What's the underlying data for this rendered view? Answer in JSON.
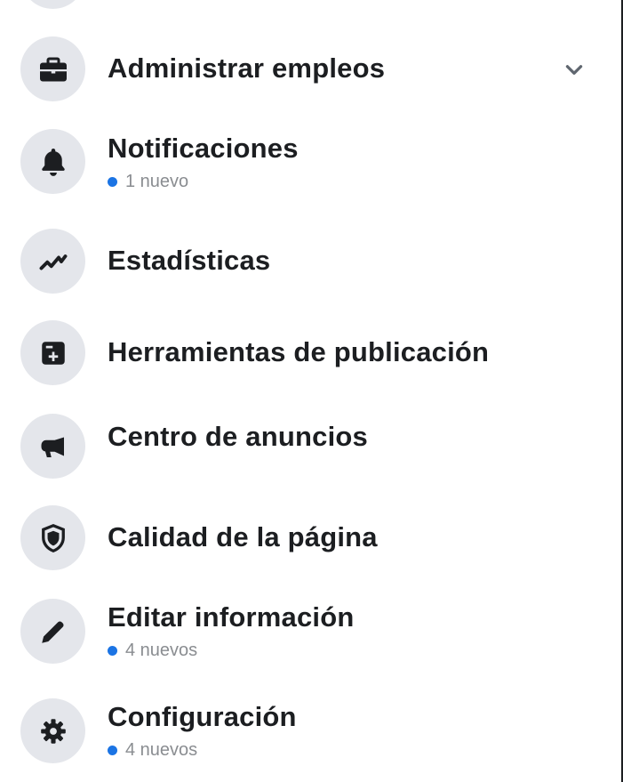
{
  "menu": {
    "items": [
      {
        "id": "administrar-empleos",
        "label": "Administrar empleos",
        "icon": "briefcase-icon",
        "expandable": true
      },
      {
        "id": "notificaciones",
        "label": "Notificaciones",
        "icon": "bell-icon",
        "badge": "1 nuevo"
      },
      {
        "id": "estadisticas",
        "label": "Estadísticas",
        "icon": "trend-line-icon"
      },
      {
        "id": "herramientas",
        "label": "Herramientas de publicación",
        "icon": "publishing-tools-icon"
      },
      {
        "id": "anuncios",
        "label": "Centro de anuncios",
        "icon": "megaphone-icon"
      },
      {
        "id": "calidad",
        "label": "Calidad de la página",
        "icon": "shield-icon"
      },
      {
        "id": "editar",
        "label": "Editar información",
        "icon": "pencil-icon",
        "badge": "4 nuevos"
      },
      {
        "id": "configuracion",
        "label": "Configuración",
        "icon": "gear-icon",
        "badge": "4 nuevos"
      }
    ]
  },
  "colors": {
    "icon_bg": "#e4e6eb",
    "text": "#1c1e21",
    "secondary_text": "#8a8d91",
    "badge_dot": "#1b74e4"
  }
}
